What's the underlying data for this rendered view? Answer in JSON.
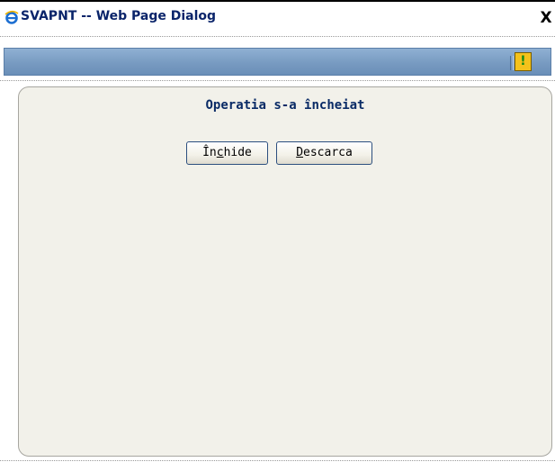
{
  "window": {
    "title": "SVAPNT -- Web Page Dialog",
    "close_label": "X",
    "icon": "ie-icon"
  },
  "toolbar": {
    "warning_icon": "exclamation-icon",
    "warning_glyph": "!",
    "accent_color": "#7699c0"
  },
  "content": {
    "heading": "Operatia s-a încheiat",
    "buttons": {
      "close": {
        "pre": "În",
        "accel": "c",
        "post": "hide"
      },
      "download": {
        "pre": "",
        "accel": "D",
        "post": "escarca"
      }
    }
  }
}
